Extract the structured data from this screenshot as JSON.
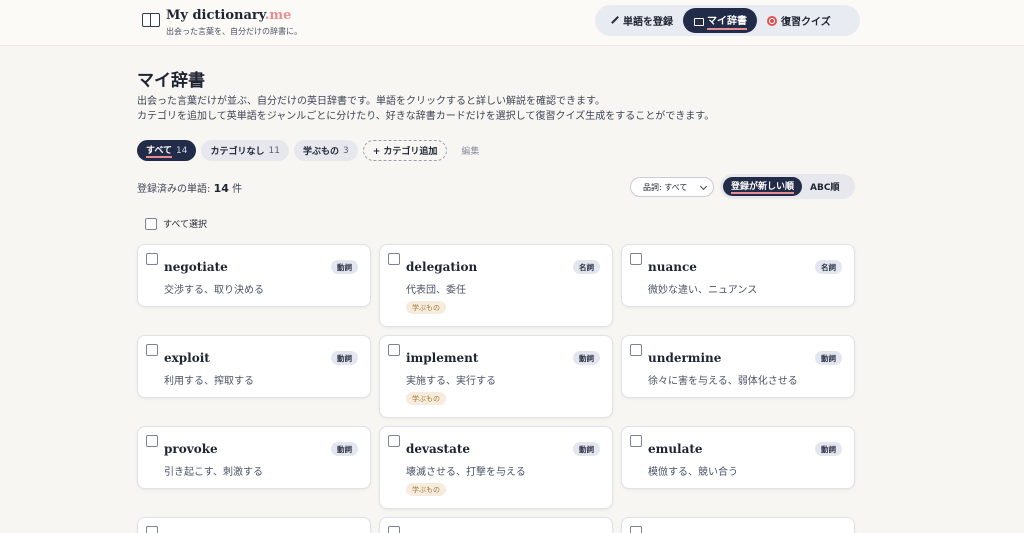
{
  "header": {
    "brand_name": "My dictionary",
    "brand_suffix": ".me",
    "tagline": "出会った言葉を、自分だけの辞書に。",
    "nav": [
      {
        "label": "単語を登録",
        "icon": "pencil-icon"
      },
      {
        "label": "マイ辞書",
        "icon": "book-icon",
        "active": true
      },
      {
        "label": "復習クイズ",
        "icon": "dart-icon"
      }
    ]
  },
  "main": {
    "title": "マイ辞書",
    "description_line1": "出会った言葉だけが並ぶ、自分だけの英日辞書です。単語をクリックすると詳しい解説を確認できます。",
    "description_line2": "カテゴリを追加して英単語をジャンルごとに分けたり、好きな辞書カードだけを選択して復習クイズ生成をすることができます。",
    "filters": [
      {
        "label": "すべて",
        "count": "14",
        "active": true
      },
      {
        "label": "カテゴリなし",
        "count": "11"
      },
      {
        "label": "学ぶもの",
        "count": "3"
      }
    ],
    "add_category": "+ カテゴリ追加",
    "edit": "編集",
    "count_label": "登録済みの単語:",
    "count_value": "14",
    "count_unit": "件",
    "pos_filter": "品詞: すべて",
    "sort": {
      "newest": "登録が新しい順",
      "abc": "ABC順"
    },
    "select_all": "すべて選択"
  },
  "cards": [
    {
      "word": "negotiate",
      "pos": "動詞",
      "meaning": "交渉する、取り決める",
      "tag": ""
    },
    {
      "word": "delegation",
      "pos": "名詞",
      "meaning": "代表団、委任",
      "tag": "学ぶもの"
    },
    {
      "word": "nuance",
      "pos": "名詞",
      "meaning": "微妙な違い、ニュアンス",
      "tag": ""
    },
    {
      "word": "exploit",
      "pos": "動詞",
      "meaning": "利用する、搾取する",
      "tag": ""
    },
    {
      "word": "implement",
      "pos": "動詞",
      "meaning": "実施する、実行する",
      "tag": "学ぶもの"
    },
    {
      "word": "undermine",
      "pos": "動詞",
      "meaning": "徐々に害を与える、弱体化させる",
      "tag": ""
    },
    {
      "word": "provoke",
      "pos": "動詞",
      "meaning": "引き起こす、刺激する",
      "tag": ""
    },
    {
      "word": "devastate",
      "pos": "動詞",
      "meaning": "壊滅させる、打撃を与える",
      "tag": "学ぶもの"
    },
    {
      "word": "emulate",
      "pos": "動詞",
      "meaning": "模倣する、競い合う",
      "tag": ""
    }
  ]
}
